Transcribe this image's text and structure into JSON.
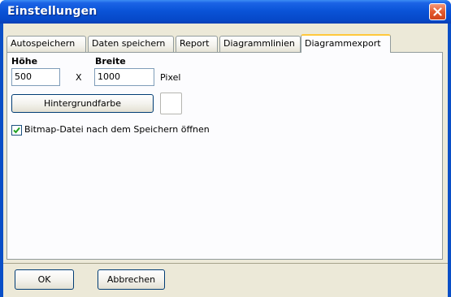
{
  "window": {
    "title": "Einstellungen",
    "close_icon": "close-icon"
  },
  "tabs": [
    {
      "label": "Autospeichern",
      "active": false
    },
    {
      "label": "Daten speichern",
      "active": false
    },
    {
      "label": "Report",
      "active": false
    },
    {
      "label": "Diagrammlinien",
      "active": false
    },
    {
      "label": "Diagrammexport",
      "active": true
    }
  ],
  "export": {
    "height_label": "Höhe",
    "width_label": "Breite",
    "height_value": "500",
    "separator": "X",
    "width_value": "1000",
    "unit_label": "Pixel",
    "background_button": "Hintergrundfarbe",
    "background_color": "#ffffff",
    "open_bitmap_label": "Bitmap-Datei nach dem Speichern öffnen",
    "open_bitmap_checked": true
  },
  "footer": {
    "ok_label": "OK",
    "cancel_label": "Abbrechen"
  },
  "colors": {
    "titlebar": "#0a54d8",
    "dialog_face": "#ece9d8",
    "active_tab_accent": "#ffc83c",
    "close_button": "#e45a2e"
  }
}
